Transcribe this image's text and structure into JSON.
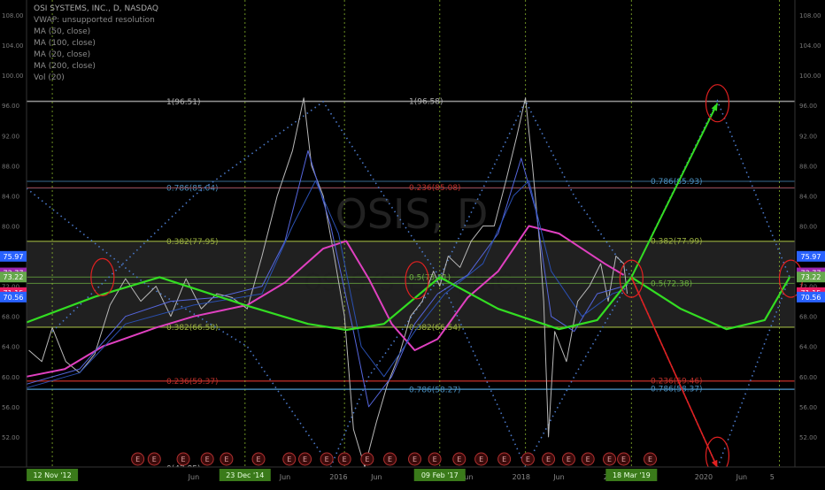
{
  "header": {
    "lines": [
      "OSI SYSTEMS, INC., D, NASDAQ",
      "VWAP: unsupported resolution",
      "MA (50, close)",
      "MA (100, close)",
      "MA (20, close)",
      "MA (200, close)",
      "Vol (20)"
    ]
  },
  "watermark": {
    "symbol": "OSIS, D",
    "name": "OSI SYSTEMS, INC."
  },
  "chart_data": {
    "type": "line",
    "ylim": [
      48,
      110
    ],
    "xlim": [
      "2012-08-01",
      "2020-12-31"
    ],
    "y_ticks": [
      52,
      56,
      60,
      64,
      68,
      72,
      76,
      80,
      84,
      88,
      92,
      96,
      100,
      104,
      108
    ],
    "y_tick_labels": [
      "52.00",
      "56.00",
      "60.00",
      "64.00",
      "68.00",
      "72.00",
      "76.00",
      "80.00",
      "84.00",
      "88.00",
      "92.00",
      "96.00",
      "100.00",
      "104.00",
      "108.00"
    ],
    "x_tick_labels": [
      {
        "date": "2014-06-01",
        "label": "Jun"
      },
      {
        "date": "2015-06-01",
        "label": "Jun"
      },
      {
        "date": "2016-01-01",
        "label": "2016"
      },
      {
        "date": "2016-06-01",
        "label": "Jun"
      },
      {
        "date": "2017-06-01",
        "label": "Jun"
      },
      {
        "date": "2018-01-01",
        "label": "2018"
      },
      {
        "date": "2018-06-01",
        "label": "Jun"
      },
      {
        "date": "2019-01-01",
        "label": "2019"
      },
      {
        "date": "2020-01-01",
        "label": "2020"
      },
      {
        "date": "2020-06-01",
        "label": "Jun"
      },
      {
        "date": "2020-10-01",
        "label": "5"
      }
    ],
    "date_markers": [
      {
        "date": "2012-11-12",
        "label": "12 Nov '12"
      },
      {
        "date": "2014-12-23",
        "label": "23 Dec '14"
      },
      {
        "date": "2017-02-09",
        "label": "09 Feb '17"
      },
      {
        "date": "2019-03-18",
        "label": "18 Mar '19"
      }
    ],
    "extra_vlines": [
      "2016-01-25",
      "2018-01-18",
      "2020-10-30"
    ],
    "earnings_dates": [
      "2013-10-20",
      "2013-12-25",
      "2014-04-20",
      "2014-07-25",
      "2014-10-10",
      "2015-02-15",
      "2015-06-18",
      "2015-08-20",
      "2015-11-15",
      "2016-01-25",
      "2016-04-25",
      "2016-07-25",
      "2016-11-01",
      "2017-01-20",
      "2017-04-28",
      "2017-07-25",
      "2017-10-25",
      "2018-01-28",
      "2018-04-20",
      "2018-07-10",
      "2018-09-25",
      "2018-12-20",
      "2019-02-15",
      "2019-06-01"
    ],
    "price_axis_labels": [
      {
        "value": 75.97,
        "label": "75.97",
        "color": "#2962ff"
      },
      {
        "value": 73.77,
        "label": "73.77",
        "color": "#9c27b0"
      },
      {
        "value": 73.22,
        "label": "73.22",
        "color": "#66a84c"
      },
      {
        "value": 71.15,
        "label": "71.15",
        "color": "#e91e63"
      },
      {
        "value": 70.56,
        "label": "70.56",
        "color": "#2962ff"
      }
    ],
    "fib_levels": [
      {
        "value": 96.51,
        "label": "1(96.51)",
        "color": "#b0b0b0"
      },
      {
        "value": 96.58,
        "label": "1(96.58)",
        "color": "#b0b0b0"
      },
      {
        "value": 85.93,
        "label": "0.786(85.93)",
        "color": "#4a90c0"
      },
      {
        "value": 85.04,
        "label": "0.786(85.04)",
        "color": "#4a90c0"
      },
      {
        "value": 85.08,
        "label": "0.236(85.08)",
        "color": "#c0302a"
      },
      {
        "value": 77.99,
        "label": "0.382(77.99)",
        "color": "#9ab040"
      },
      {
        "value": 77.95,
        "label": "0.382(77.95)",
        "color": "#9ab040"
      },
      {
        "value": 73.21,
        "label": "0.5(73.21)",
        "color": "#6cb040"
      },
      {
        "value": 72.38,
        "label": "0.5(72.38)",
        "color": "#6cb040"
      },
      {
        "value": 66.58,
        "label": "0.382(66.58)",
        "color": "#9ab040"
      },
      {
        "value": 66.54,
        "label": "0.382(66.54)",
        "color": "#9ab040"
      },
      {
        "value": 59.46,
        "label": "0.236(59.46)",
        "color": "#c0302a"
      },
      {
        "value": 59.37,
        "label": "0.236(59.37)",
        "color": "#c0302a"
      },
      {
        "value": 58.27,
        "label": "0.786(58.27)",
        "color": "#4a90c0"
      },
      {
        "value": 58.37,
        "label": "0.786(58.37)",
        "color": "#4a90c0"
      },
      {
        "value": 47.85,
        "label": "0(47.85)",
        "color": "#b0b0b0"
      }
    ],
    "series": [
      {
        "color": "#b8b8b8",
        "width": 1,
        "points": [
          [
            "2012-08-10",
            63.5
          ],
          [
            "2012-10-01",
            62
          ],
          [
            "2012-11-12",
            66.5
          ],
          [
            "2013-01-05",
            62
          ],
          [
            "2013-03-01",
            60.5
          ],
          [
            "2013-05-01",
            63
          ],
          [
            "2013-07-01",
            69.5
          ],
          [
            "2013-09-01",
            73
          ],
          [
            "2013-11-01",
            70
          ],
          [
            "2014-01-01",
            72
          ],
          [
            "2014-03-01",
            68
          ],
          [
            "2014-05-01",
            73
          ],
          [
            "2014-07-01",
            69
          ],
          [
            "2014-09-01",
            71
          ],
          [
            "2014-11-01",
            70.5
          ],
          [
            "2015-01-01",
            69
          ],
          [
            "2015-03-01",
            76
          ],
          [
            "2015-05-01",
            84
          ],
          [
            "2015-07-01",
            90
          ],
          [
            "2015-08-15",
            97
          ],
          [
            "2015-09-15",
            88
          ],
          [
            "2015-11-01",
            84
          ],
          [
            "2015-12-15",
            76
          ],
          [
            "2016-01-25",
            68
          ],
          [
            "2016-03-01",
            53
          ],
          [
            "2016-04-15",
            48
          ],
          [
            "2016-06-01",
            54
          ],
          [
            "2016-07-15",
            59
          ],
          [
            "2016-09-01",
            63
          ],
          [
            "2016-10-15",
            68
          ],
          [
            "2016-12-01",
            70
          ],
          [
            "2017-01-15",
            74
          ],
          [
            "2017-02-09",
            72
          ],
          [
            "2017-03-15",
            76
          ],
          [
            "2017-05-01",
            74.5
          ],
          [
            "2017-06-15",
            78
          ],
          [
            "2017-08-01",
            80
          ],
          [
            "2017-09-15",
            80
          ],
          [
            "2017-11-01",
            86
          ],
          [
            "2017-12-15",
            92
          ],
          [
            "2018-01-18",
            97
          ],
          [
            "2018-02-15",
            88
          ],
          [
            "2018-03-15",
            78
          ],
          [
            "2018-04-01",
            70
          ],
          [
            "2018-04-20",
            52
          ],
          [
            "2018-05-15",
            66
          ],
          [
            "2018-07-01",
            62
          ],
          [
            "2018-08-15",
            70
          ],
          [
            "2018-10-01",
            72
          ],
          [
            "2018-11-15",
            75
          ],
          [
            "2018-12-15",
            70
          ],
          [
            "2019-01-15",
            76
          ],
          [
            "2019-02-15",
            75
          ],
          [
            "2019-03-01",
            71
          ]
        ]
      },
      {
        "color": "#e040c0",
        "width": 2,
        "points": [
          [
            "2012-08-01",
            60
          ],
          [
            "2013-01-01",
            61
          ],
          [
            "2013-06-01",
            64
          ],
          [
            "2014-01-01",
            66.5
          ],
          [
            "2014-06-01",
            68
          ],
          [
            "2015-01-01",
            69.5
          ],
          [
            "2015-06-01",
            72.5
          ],
          [
            "2015-11-01",
            77
          ],
          [
            "2016-02-01",
            78
          ],
          [
            "2016-05-01",
            73
          ],
          [
            "2016-08-01",
            67
          ],
          [
            "2016-11-01",
            63.5
          ],
          [
            "2017-02-01",
            65
          ],
          [
            "2017-06-01",
            70.5
          ],
          [
            "2017-10-01",
            74
          ],
          [
            "2018-02-01",
            80
          ],
          [
            "2018-06-01",
            79
          ],
          [
            "2018-09-01",
            77
          ],
          [
            "2018-12-01",
            75
          ],
          [
            "2019-02-15",
            73.5
          ]
        ]
      },
      {
        "color": "#5566dd",
        "width": 1,
        "points": [
          [
            "2012-08-01",
            59
          ],
          [
            "2013-03-01",
            61
          ],
          [
            "2013-09-01",
            68
          ],
          [
            "2014-03-01",
            70
          ],
          [
            "2014-09-01",
            70.5
          ],
          [
            "2015-03-01",
            72
          ],
          [
            "2015-06-01",
            78
          ],
          [
            "2015-09-01",
            90
          ],
          [
            "2015-12-01",
            80
          ],
          [
            "2016-03-01",
            66
          ],
          [
            "2016-05-01",
            56
          ],
          [
            "2016-08-01",
            60
          ],
          [
            "2016-11-01",
            67
          ],
          [
            "2017-02-01",
            71
          ],
          [
            "2017-06-01",
            73.5
          ],
          [
            "2017-10-01",
            79
          ],
          [
            "2018-01-01",
            89
          ],
          [
            "2018-03-01",
            82
          ],
          [
            "2018-05-01",
            68
          ],
          [
            "2018-08-01",
            66
          ],
          [
            "2018-11-01",
            71
          ],
          [
            "2019-02-15",
            72
          ]
        ]
      },
      {
        "color": "#2a4fb0",
        "width": 1,
        "points": [
          [
            "2012-08-01",
            58.5
          ],
          [
            "2013-03-01",
            60.5
          ],
          [
            "2013-09-01",
            67
          ],
          [
            "2014-06-01",
            69.5
          ],
          [
            "2015-03-01",
            71
          ],
          [
            "2015-07-01",
            80
          ],
          [
            "2015-10-01",
            86
          ],
          [
            "2016-01-01",
            79
          ],
          [
            "2016-04-01",
            64
          ],
          [
            "2016-07-01",
            60
          ],
          [
            "2016-11-01",
            66
          ],
          [
            "2017-03-01",
            71
          ],
          [
            "2017-08-01",
            75
          ],
          [
            "2017-12-01",
            84
          ],
          [
            "2018-02-01",
            86
          ],
          [
            "2018-05-01",
            74
          ],
          [
            "2018-09-01",
            68
          ],
          [
            "2019-01-01",
            71
          ],
          [
            "2019-02-15",
            71.5
          ]
        ]
      },
      {
        "color": "#33dd22",
        "width": 2.2,
        "points": [
          [
            "2012-08-01",
            67.2
          ],
          [
            "2013-05-01",
            70.6
          ],
          [
            "2014-01-15",
            73.2
          ],
          [
            "2014-12-23",
            69.5
          ],
          [
            "2015-09-01",
            67
          ],
          [
            "2016-02-01",
            66.2
          ],
          [
            "2016-07-01",
            67
          ],
          [
            "2017-02-09",
            73.2
          ],
          [
            "2017-10-01",
            69
          ],
          [
            "2018-06-01",
            66.3
          ],
          [
            "2018-11-01",
            67.5
          ],
          [
            "2019-03-18",
            73.2
          ],
          [
            "2019-10-01",
            69
          ],
          [
            "2020-04-01",
            66.3
          ],
          [
            "2020-09-01",
            67.5
          ],
          [
            "2020-12-10",
            73.2
          ]
        ]
      },
      {
        "color": "#33dd22",
        "width": 2,
        "points": [
          [
            "2019-03-18",
            73.2
          ],
          [
            "2020-02-25",
            96.3
          ]
        ]
      },
      {
        "color": "#e02020",
        "width": 1.6,
        "points": [
          [
            "2019-03-18",
            73.2
          ],
          [
            "2020-02-25",
            47.9
          ]
        ]
      }
    ],
    "dotted_zigzag": [
      {
        "color": "#4a78c8",
        "points": [
          [
            "2012-08-01",
            85
          ],
          [
            "2013-12-01",
            72
          ],
          [
            "2015-01-01",
            64
          ],
          [
            "2015-12-01",
            48
          ],
          [
            "2016-05-01",
            60
          ],
          [
            "2017-02-09",
            73.2
          ],
          [
            "2018-01-18",
            96.6
          ],
          [
            "2018-08-01",
            84
          ],
          [
            "2019-03-18",
            73.2
          ],
          [
            "2020-02-25",
            96.6
          ],
          [
            "2020-12-10",
            73.2
          ]
        ]
      },
      {
        "color": "#4a78c8",
        "points": [
          [
            "2012-11-12",
            66
          ],
          [
            "2014-06-01",
            84
          ],
          [
            "2015-11-01",
            96.5
          ],
          [
            "2016-07-01",
            84
          ],
          [
            "2017-02-09",
            73.2
          ],
          [
            "2018-01-18",
            48
          ],
          [
            "2018-08-01",
            60
          ],
          [
            "2019-03-18",
            73.2
          ],
          [
            "2020-02-25",
            47.9
          ],
          [
            "2020-12-10",
            73.2
          ]
        ]
      }
    ],
    "highlight_circles": [
      {
        "date": "2013-06-01",
        "value": 73.2
      },
      {
        "date": "2016-11-10",
        "value": 72.8
      },
      {
        "date": "2019-03-18",
        "value": 73.0
      },
      {
        "date": "2020-02-25",
        "value": 96.3
      },
      {
        "date": "2020-02-25",
        "value": 49.5
      },
      {
        "date": "2020-12-15",
        "value": 73.0
      }
    ],
    "band": {
      "from": 66.5,
      "to": 78.0,
      "color": "#3a3a3a"
    }
  }
}
